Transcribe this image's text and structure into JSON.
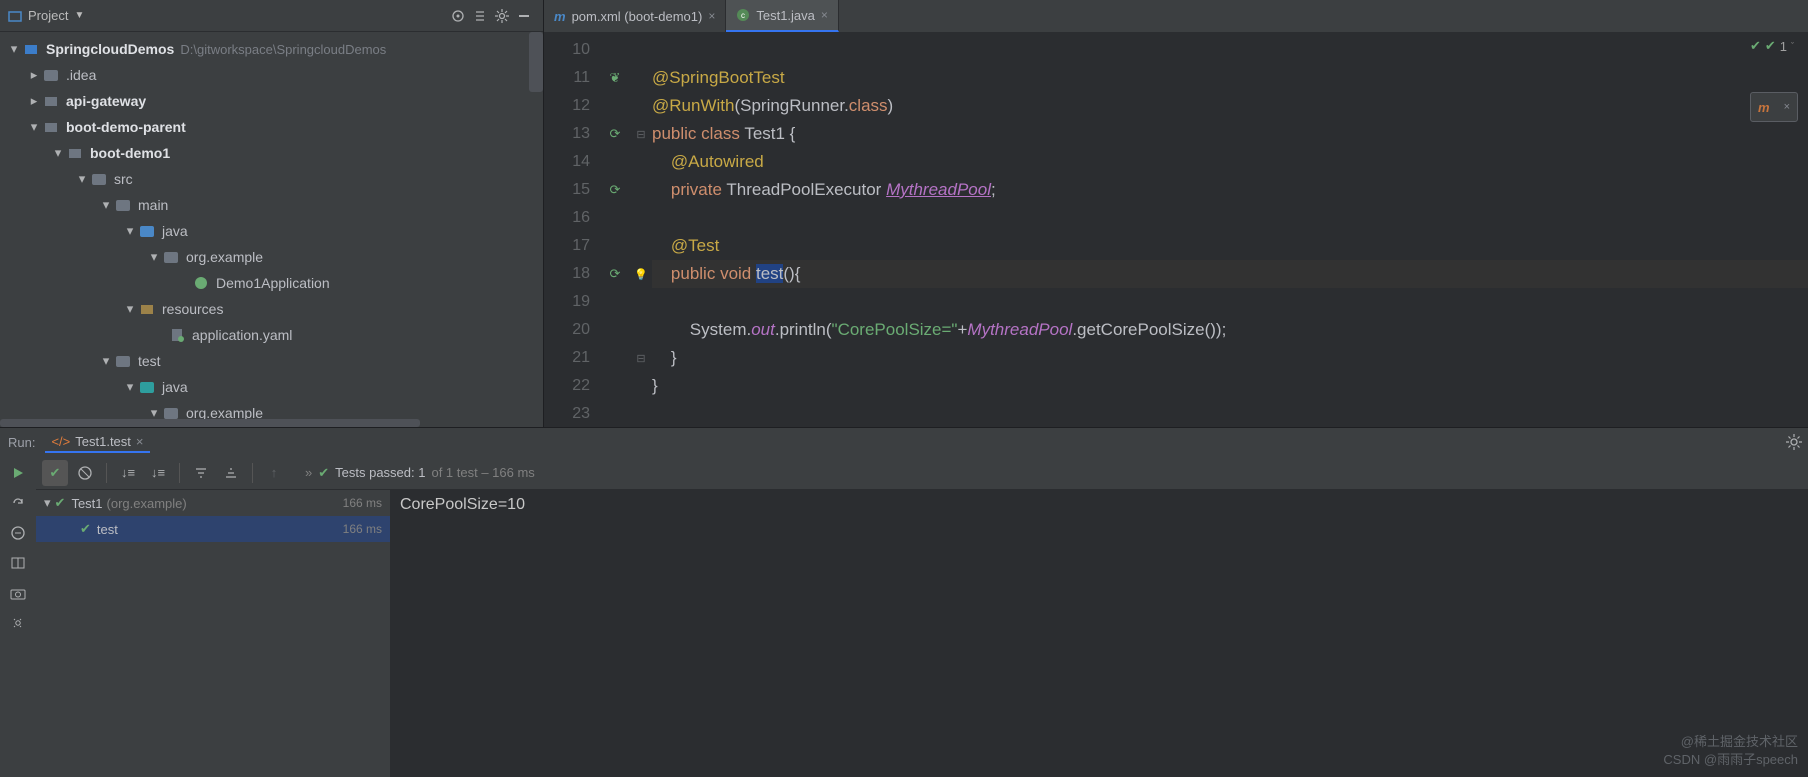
{
  "sidebar": {
    "title": "Project",
    "root": {
      "name": "SpringcloudDemos",
      "path": "D:\\gitworkspace\\SpringcloudDemos"
    },
    "nodes": {
      "idea": ".idea",
      "api_gateway": "api-gateway",
      "boot_demo_parent": "boot-demo-parent",
      "boot_demo1": "boot-demo1",
      "src": "src",
      "main": "main",
      "java": "java",
      "org_example": "org.example",
      "demo1_app": "Demo1Application",
      "resources": "resources",
      "app_yaml": "application.yaml",
      "test": "test",
      "java2": "java",
      "org_example2": "org.example"
    }
  },
  "tabs": {
    "pom": "pom.xml (boot-demo1)",
    "test1": "Test1.java"
  },
  "editor": {
    "indicator": "1",
    "lines": [
      "10",
      "11",
      "12",
      "13",
      "14",
      "15",
      "16",
      "17",
      "18",
      "19",
      "20",
      "21",
      "22",
      "23"
    ],
    "t": {
      "ann_sbt": "@SpringBootTest",
      "ann_rw": "@RunWith",
      "rw_arg_a": "(SpringRunner.",
      "rw_arg_b": "class",
      "rw_arg_c": ")",
      "pub": "public",
      "cls": "class",
      "test1": "Test1",
      "brace_o": " {",
      "ann_aw": "@Autowired",
      "priv": "private",
      "tpe": "ThreadPoolExecutor",
      "fld": "MythreadPool",
      "semi": ";",
      "ann_test": "@Test",
      "void": "void",
      "mname": "test",
      "paren": "(){",
      "sys_a": "System.",
      "sys_out": "out",
      "sys_b": ".println(",
      "str": "\"CorePoolSize=\"",
      "plus": "+",
      "gcp": ".getCorePoolSize());",
      "brace_c1": "}",
      "brace_c2": "}"
    }
  },
  "run": {
    "label": "Run:",
    "tab": "Test1.test",
    "msg_a": "»",
    "msg_b": "Tests passed: 1",
    "msg_c": " of 1 test – 166 ms",
    "row1_name": "Test1",
    "row1_pkg": "(org.example)",
    "row1_time": "166 ms",
    "row2_name": "test",
    "row2_time": "166 ms",
    "console": "CorePoolSize=10"
  },
  "watermark": {
    "l1": "@稀土掘金技术社区",
    "l2": "CSDN @雨雨子speech"
  }
}
